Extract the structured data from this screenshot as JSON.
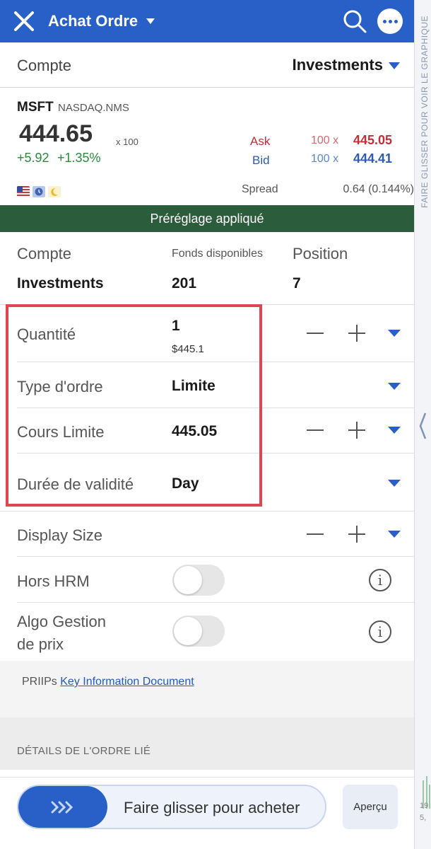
{
  "header": {
    "title": "Achat Ordre",
    "close_icon": "close-icon",
    "search_icon": "search-icon",
    "more_icon": "more-options-icon",
    "color": "#2960c8"
  },
  "side_panel": {
    "label": "FAIRE GLISSER POUR VOIR LE GRAPHIQUE",
    "bottom_text_1": "19",
    "bottom_text_2": "5,"
  },
  "account": {
    "label": "Compte",
    "value": "Investments"
  },
  "quote": {
    "symbol": "MSFT",
    "exchange": "NASDAQ.NMS",
    "price": "444.65",
    "multiplier": "x 100",
    "change": "+5.92",
    "change_pct": "+1.35%",
    "ask_label": "Ask",
    "ask_qty": "100 x",
    "ask_price": "445.05",
    "bid_label": "Bid",
    "bid_qty": "100 x",
    "bid_price": "444.41",
    "spread_label": "Spread",
    "spread_value": "0.64 (0.144%)",
    "status_icons": [
      "us-flag-icon",
      "clock-icon",
      "moon-icon"
    ]
  },
  "preset_banner": "Préréglage appliqué",
  "summary": {
    "account_label": "Compte",
    "funds_label": "Fonds disponibles",
    "position_label": "Position",
    "account_value": "Investments",
    "funds_value": "201",
    "position_value": "7"
  },
  "order_fields": {
    "quantity_label": "Quantité",
    "quantity_value": "1",
    "quantity_sub": "$445.1",
    "order_type_label": "Type d'ordre",
    "order_type_value": "Limite",
    "limit_price_label": "Cours Limite",
    "limit_price_value": "445.05",
    "validity_label": "Durée de validité",
    "validity_value": "Day",
    "display_size_label": "Display Size",
    "outside_rth_label": "Hors HRM",
    "algo_label_1": "Algo Gestion",
    "algo_label_2": "de prix"
  },
  "priips": {
    "prefix": "PRIIPs",
    "link": "Key Information Document"
  },
  "details_title": "DÉTAILS DE L'ORDRE LIÉ",
  "footer": {
    "slide_label": "Faire glisser pour acheter",
    "preview_label": "Aperçu"
  }
}
